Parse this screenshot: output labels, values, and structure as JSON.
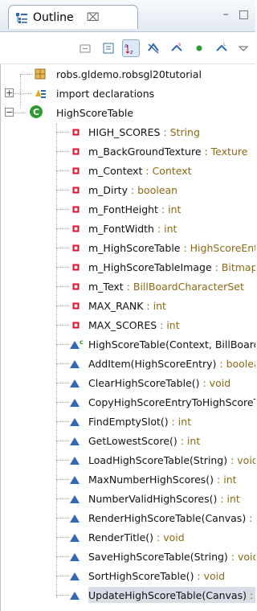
{
  "view": {
    "title": "Outline",
    "close_glyph": "⌧",
    "minimize_glyph": "–",
    "maximize_glyph": "□"
  },
  "toolbar": {
    "buttons": [
      {
        "name": "collapse-all-icon"
      },
      {
        "name": "show-document-icon"
      },
      {
        "name": "sort-icon",
        "pressed": true
      },
      {
        "name": "hide-fields-icon"
      },
      {
        "name": "hide-static-icon"
      },
      {
        "name": "hide-non-public-icon"
      },
      {
        "name": "hide-local-types-icon"
      },
      {
        "name": "view-menu-icon"
      }
    ]
  },
  "tree": {
    "package": "robs.gldemo.robsgl20tutorial",
    "imports": "import declarations",
    "class_name": "HighScoreTable",
    "members": [
      {
        "kind": "field",
        "name": "HIGH_SCORES",
        "type": " : String"
      },
      {
        "kind": "field",
        "name": "m_BackGroundTexture",
        "type": " : Texture"
      },
      {
        "kind": "field",
        "name": "m_Context",
        "type": " : Context"
      },
      {
        "kind": "field",
        "name": "m_Dirty",
        "type": " : boolean"
      },
      {
        "kind": "field",
        "name": "m_FontHeight",
        "type": " : int"
      },
      {
        "kind": "field",
        "name": "m_FontWidth",
        "type": " : int"
      },
      {
        "kind": "field",
        "name": "m_HighScoreTable",
        "type": " : HighScoreEntry[]"
      },
      {
        "kind": "field",
        "name": "m_HighScoreTableImage",
        "type": " : Bitmap"
      },
      {
        "kind": "field",
        "name": "m_Text",
        "type": " : BillBoardCharacterSet"
      },
      {
        "kind": "field",
        "name": "MAX_RANK",
        "type": " : int"
      },
      {
        "kind": "field",
        "name": "MAX_SCORES",
        "type": " : int"
      },
      {
        "kind": "constructor",
        "name": "HighScoreTable(Context, BillBoardCharacterSet)",
        "type": ""
      },
      {
        "kind": "method",
        "name": "AddItem(HighScoreEntry)",
        "type": " : boolean"
      },
      {
        "kind": "method",
        "name": "ClearHighScoreTable()",
        "type": " : void"
      },
      {
        "kind": "method",
        "name": "CopyHighScoreEntryToHighScoreTable(int, HighScoreEntry)",
        "type": ""
      },
      {
        "kind": "method",
        "name": "FindEmptySlot()",
        "type": " : int"
      },
      {
        "kind": "method",
        "name": "GetLowestScore()",
        "type": " : int"
      },
      {
        "kind": "method",
        "name": "LoadHighScoreTable(String)",
        "type": " : void"
      },
      {
        "kind": "method",
        "name": "MaxNumberHighScores()",
        "type": " : int"
      },
      {
        "kind": "method",
        "name": "NumberValidHighScores()",
        "type": " : int"
      },
      {
        "kind": "method",
        "name": "RenderHighScoreTable(Canvas)",
        "type": " : void"
      },
      {
        "kind": "method",
        "name": "RenderTitle()",
        "type": " : void"
      },
      {
        "kind": "method",
        "name": "SaveHighScoreTable(String)",
        "type": " : void"
      },
      {
        "kind": "method",
        "name": "SortHighScoreTable()",
        "type": " : void"
      },
      {
        "kind": "method",
        "name": "UpdateHighScoreTable(Canvas)",
        "type": " : void",
        "selected": true
      }
    ]
  },
  "colors": {
    "field_icon": "#d7112b",
    "method_icon": "#2f67b8",
    "class_icon": "#2f9a2f",
    "type_text": "#8a6a14",
    "selection": "#d8dde6"
  }
}
